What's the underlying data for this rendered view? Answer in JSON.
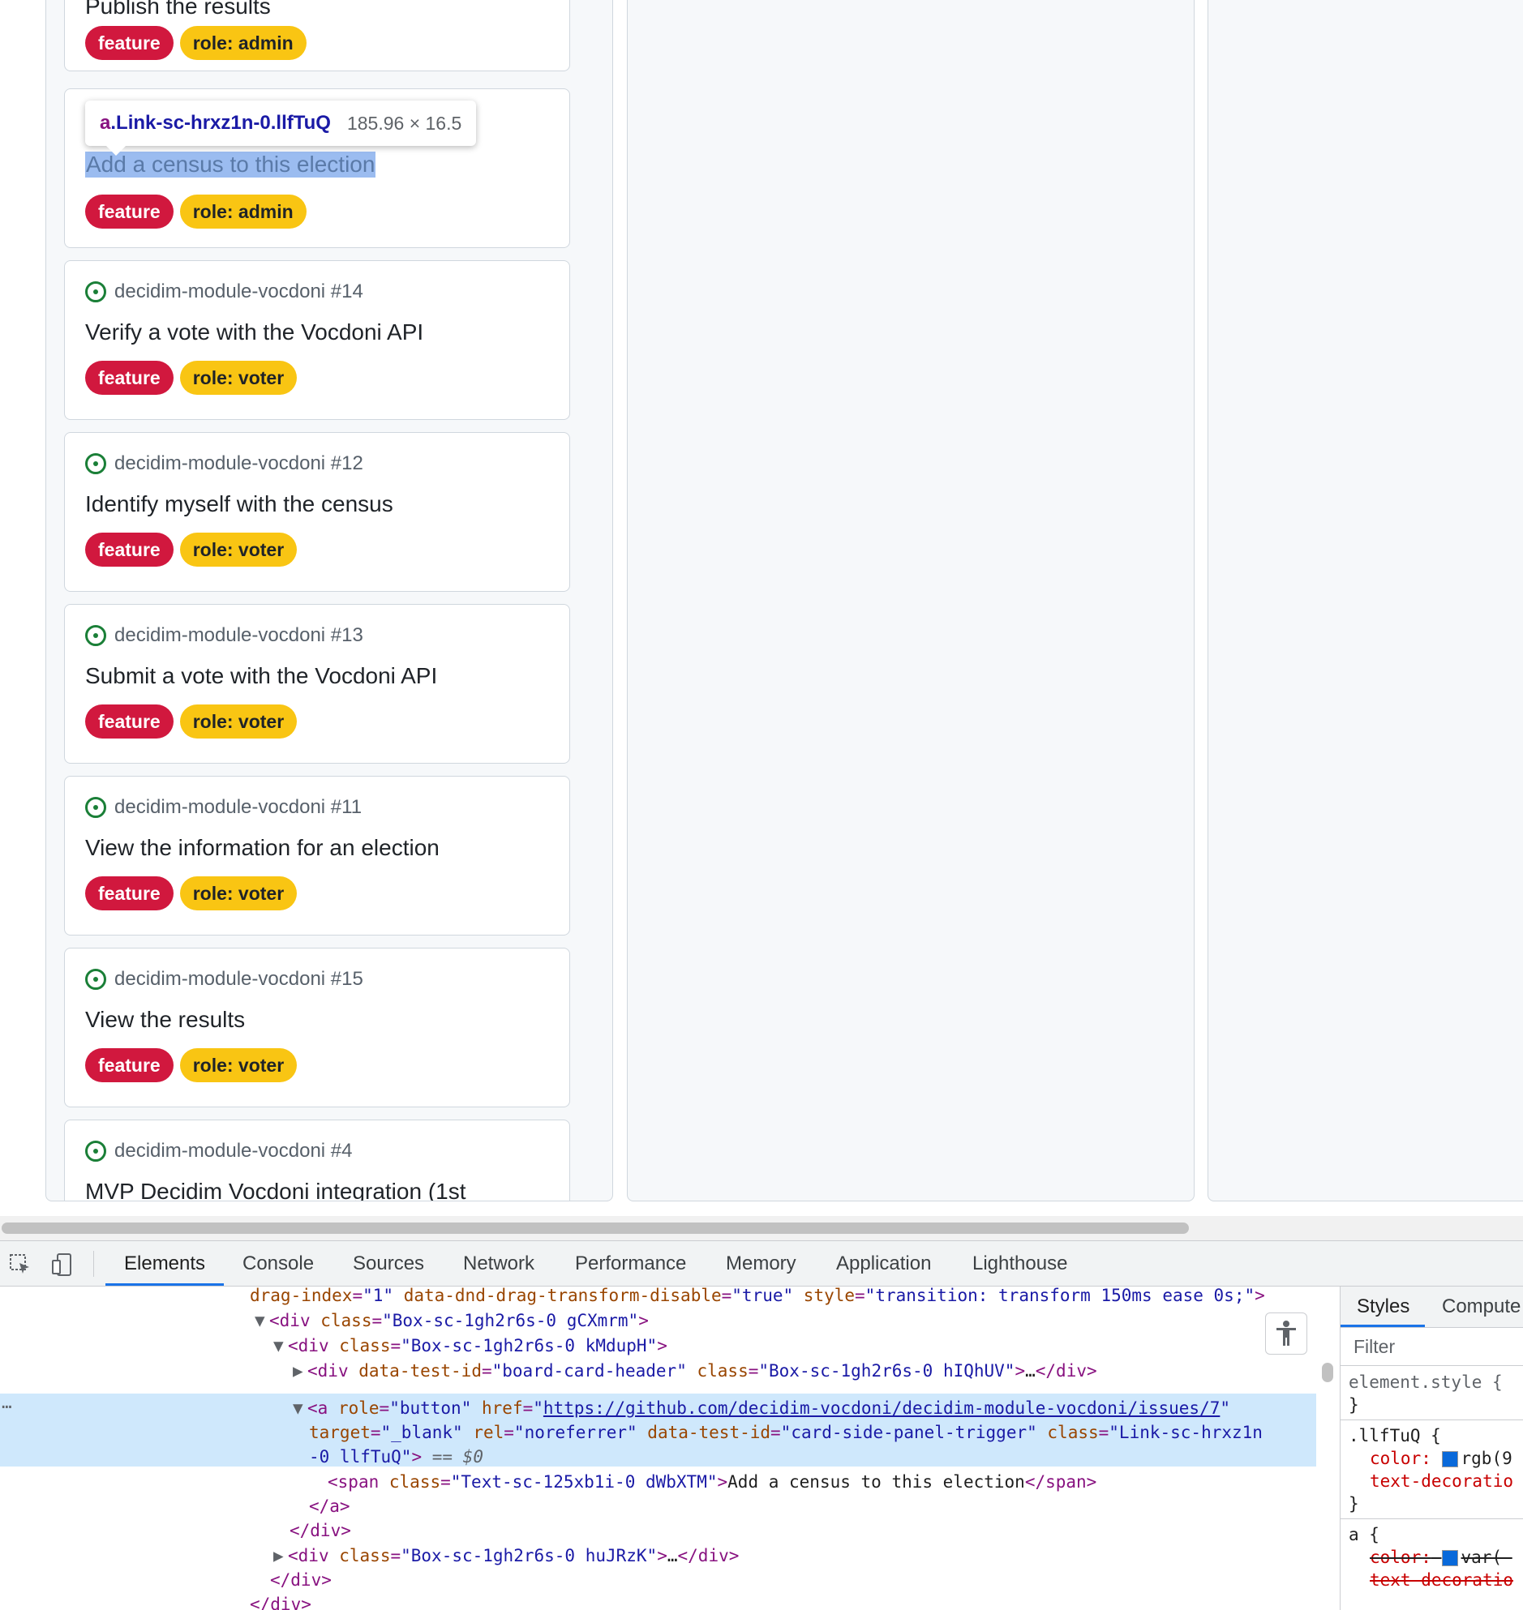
{
  "cards": [
    {
      "title": "Publish the results",
      "labels": [
        "feature",
        "role: admin"
      ]
    },
    {
      "title": "Add a census to this election",
      "labels": [
        "feature",
        "role: admin"
      ]
    },
    {
      "repo": "decidim-module-vocdoni #14",
      "title": "Verify a vote with the Vocdoni API",
      "labels": [
        "feature",
        "role: voter"
      ]
    },
    {
      "repo": "decidim-module-vocdoni #12",
      "title": "Identify myself with the census",
      "labels": [
        "feature",
        "role: voter"
      ]
    },
    {
      "repo": "decidim-module-vocdoni #13",
      "title": "Submit a vote with the Vocdoni API",
      "labels": [
        "feature",
        "role: voter"
      ]
    },
    {
      "repo": "decidim-module-vocdoni #11",
      "title": "View the information for an election",
      "labels": [
        "feature",
        "role: voter"
      ]
    },
    {
      "repo": "decidim-module-vocdoni #15",
      "title": "View the results",
      "labels": [
        "feature",
        "role: voter"
      ]
    },
    {
      "repo": "decidim-module-vocdoni #4",
      "title": "MVP Decidim Vocdoni integration (1st"
    }
  ],
  "tooltip": {
    "tag": "a",
    "class_name": ".Link-sc-hrxz1n-0.llfTuQ",
    "size": "185.96 × 16.5"
  },
  "devtools": {
    "tabs": [
      "Elements",
      "Console",
      "Sources",
      "Network",
      "Performance",
      "Memory",
      "Application",
      "Lighthouse"
    ],
    "active_tab": "Elements",
    "side_tabs": [
      "Styles",
      "Compute"
    ],
    "filter_placeholder": "Filter",
    "dom": {
      "l0": {
        "a1": "drag-index",
        "v1": "\"1\"",
        "a2": "data-dnd-drag-transform-disable",
        "v2": "\"true\"",
        "a3": "style",
        "v3": "\"transition: transform 150ms ease 0s;\""
      },
      "l1": {
        "tag": "div",
        "attr": "class",
        "val": "\"Box-sc-1gh2r6s-0 gCXmrm\""
      },
      "l2": {
        "tag": "div",
        "attr": "class",
        "val": "\"Box-sc-1gh2r6s-0 kMdupH\""
      },
      "l3": {
        "tag": "div",
        "a1": "data-test-id",
        "v1": "\"board-card-header\"",
        "a2": "class",
        "v2": "\"Box-sc-1gh2r6s-0 hIQhUV\"",
        "ellipsis": "…"
      },
      "l4": {
        "tag": "a",
        "a1": "role",
        "v1": "\"button\"",
        "a2": "href",
        "href": "https://github.com/decidim-vocdoni/decidim-module-vocdoni/issues/7"
      },
      "l5": {
        "a1": "target",
        "v1": "\"_blank\"",
        "a2": "rel",
        "v2": "\"noreferrer\"",
        "a3": "data-test-id",
        "v3": "\"card-side-panel-trigger\"",
        "a4": "class",
        "v4": "\"Link-sc-hrxz1n"
      },
      "l6": {
        "v": "-0 llfTuQ\"",
        "dollar": "== $0"
      },
      "l7": {
        "tag": "span",
        "attr": "class",
        "val": "\"Text-sc-125xb1i-0 dWbXTM\"",
        "text": "Add a census to this election"
      },
      "l10": {
        "tag": "div",
        "attr": "class",
        "val": "\"Box-sc-1gh2r6s-0 huJRzK\"",
        "ellipsis": "…"
      }
    },
    "styles": {
      "element_style": "element.style {",
      "rule1_selector": ".llfTuQ {",
      "rule1_color_prop": "color:",
      "rule1_color_val": "rgb(9",
      "rule1_td_prop": "text-decoratio",
      "rule2_selector": "a {",
      "rule2_color_prop": "color:",
      "rule2_color_val": "var(-",
      "rule2_td_prop": "text-decoratio"
    }
  },
  "colors": {
    "feature": "#d1183e",
    "role": "#f9c513",
    "issue_open": "#1a7f37",
    "devtools_accent": "#1a73e8"
  }
}
